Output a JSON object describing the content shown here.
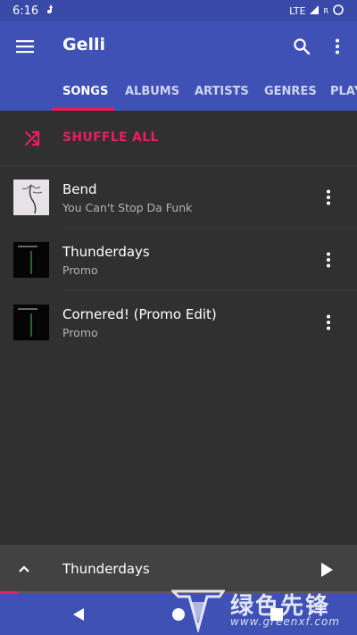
{
  "status_bar": {
    "time": "6:16",
    "network": "LTE",
    "roaming": "R"
  },
  "toolbar": {
    "title": "Gelli",
    "menu_icon": "hamburger-menu-icon",
    "search_icon": "search-icon",
    "more_icon": "more-vert-icon"
  },
  "tabs": [
    {
      "label": "SONGS",
      "active": true
    },
    {
      "label": "ALBUMS",
      "active": false
    },
    {
      "label": "ARTISTS",
      "active": false
    },
    {
      "label": "GENRES",
      "active": false
    },
    {
      "label": "PLAY",
      "active": false
    }
  ],
  "shuffle": {
    "label": "SHUFFLE ALL",
    "icon": "shuffle-icon"
  },
  "songs": [
    {
      "title": "Bend",
      "subtitle": "You Can't Stop Da Funk"
    },
    {
      "title": "Thunderdays",
      "subtitle": "Promo"
    },
    {
      "title": "Cornered! (Promo Edit)",
      "subtitle": "Promo"
    }
  ],
  "mini_player": {
    "title": "Thunderdays",
    "progress": 0.05,
    "expand_icon": "chevron-up-icon",
    "play_icon": "play-icon"
  },
  "nav_bar": {
    "back_icon": "back-icon",
    "home_icon": "home-icon",
    "recents_icon": "recents-icon"
  },
  "watermark": {
    "text": "绿色先锋",
    "url": "www.greenxf.com"
  },
  "colors": {
    "primary": "#3f51b5",
    "accent": "#e91e63",
    "background": "#303030",
    "mini_player": "#424242"
  }
}
